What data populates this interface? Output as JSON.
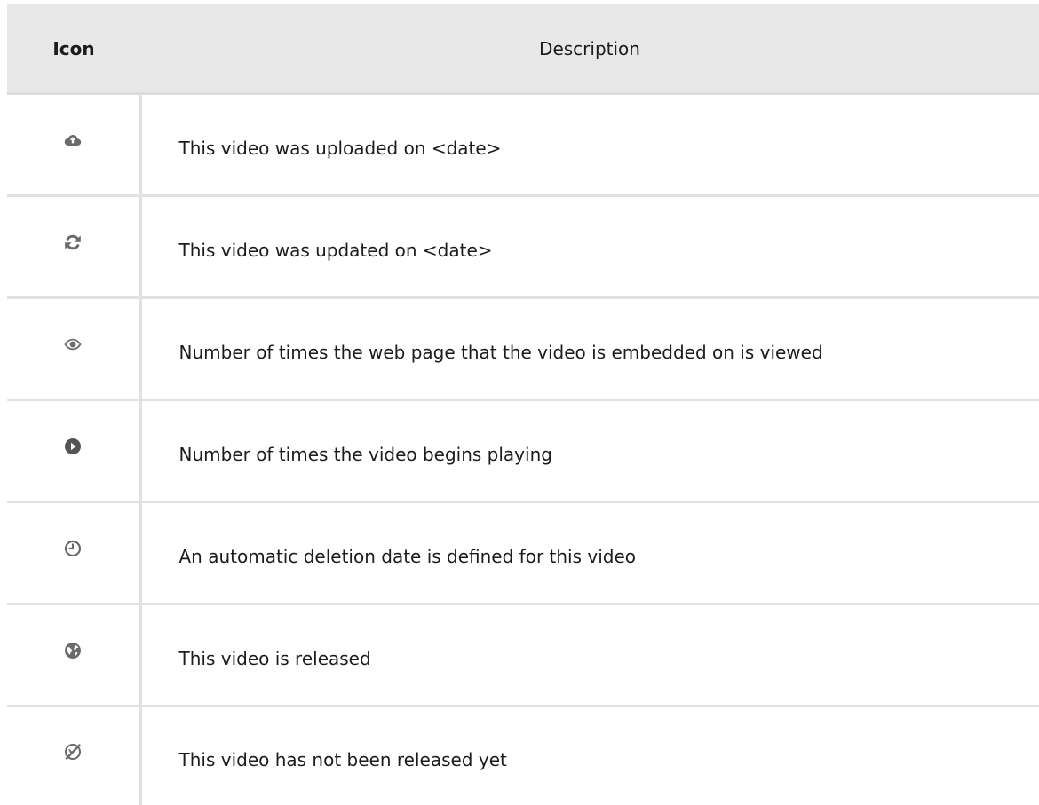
{
  "table": {
    "headers": {
      "icon": "Icon",
      "description": "Description"
    },
    "rows": [
      {
        "icon": "cloud-upload-icon",
        "description": "This video was uploaded on <date>"
      },
      {
        "icon": "refresh-icon",
        "description": "This video was updated on <date>"
      },
      {
        "icon": "eye-icon",
        "description": "Number of times the web page that the video is embedded on is viewed"
      },
      {
        "icon": "play-circle-icon",
        "description": "Number of times the video begins playing"
      },
      {
        "icon": "clock-icon",
        "description": "An automatic deletion date is defined for this video"
      },
      {
        "icon": "globe-icon",
        "description": "This video is released"
      },
      {
        "icon": "globe-off-icon",
        "description": "This video has not been released yet"
      }
    ]
  },
  "colors": {
    "icon": "#6b6b6b",
    "header_bg": "#e8e8e8",
    "border": "#e1e1e1"
  }
}
